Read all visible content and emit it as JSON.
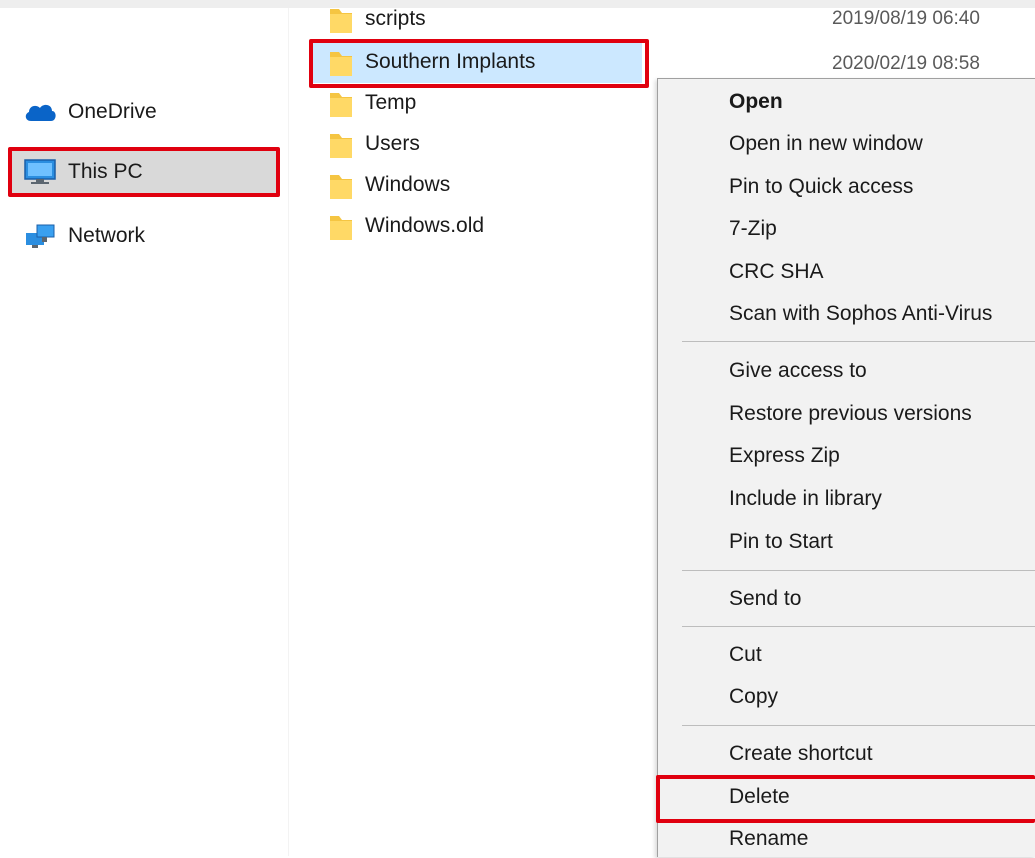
{
  "nav": {
    "items": [
      {
        "label": "OneDrive",
        "icon": "onedrive-cloud-icon"
      },
      {
        "label": "This PC",
        "icon": "computer-monitor-icon",
        "selected": true
      },
      {
        "label": "Network",
        "icon": "network-icon"
      }
    ]
  },
  "files": [
    {
      "name": "scripts",
      "date": "2019/08/19 06:40"
    },
    {
      "name": "Southern Implants",
      "date": "2020/02/19 08:58",
      "selected": true
    },
    {
      "name": "Temp",
      "date": ""
    },
    {
      "name": "Users",
      "date": ""
    },
    {
      "name": "Windows",
      "date": ""
    },
    {
      "name": "Windows.old",
      "date": ""
    }
  ],
  "context_menu": {
    "items": [
      "Open",
      "Open in new window",
      "Pin to Quick access",
      "7-Zip",
      "CRC SHA",
      "Scan with Sophos Anti-Virus",
      "Give access to",
      "Restore previous versions",
      "Express Zip",
      "Include in library",
      "Pin to Start",
      "Send to",
      "Cut",
      "Copy",
      "Create shortcut",
      "Delete",
      "Rename"
    ]
  },
  "colors": {
    "highlight_border": "#e0000f",
    "selection": "#cce8ff",
    "folder": "#f5c542"
  }
}
